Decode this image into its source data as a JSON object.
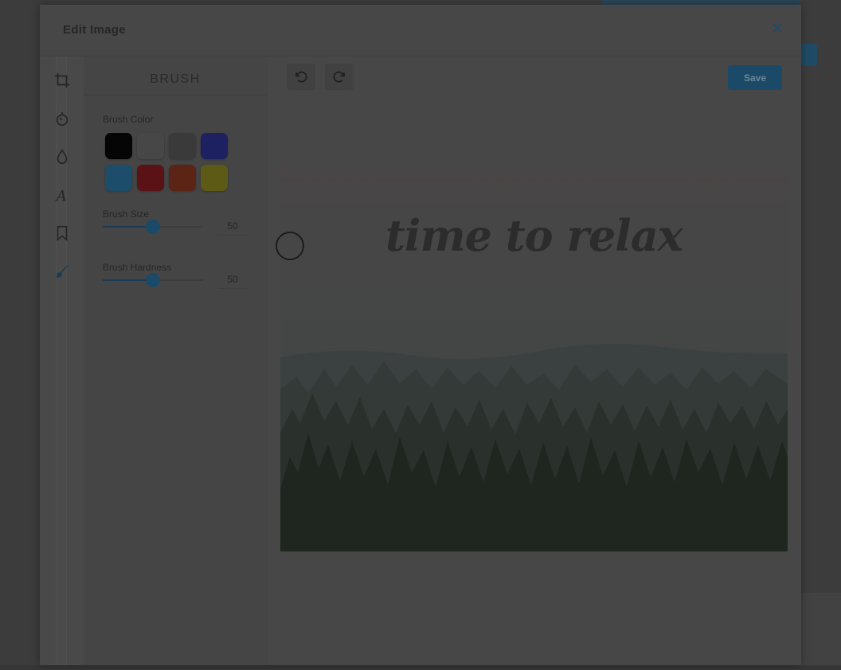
{
  "dialog": {
    "title": "Edit Image",
    "close_symbol": "✕"
  },
  "tools": [
    {
      "name": "crop-icon"
    },
    {
      "name": "brightness-icon"
    },
    {
      "name": "droplet-icon"
    },
    {
      "name": "text-icon"
    },
    {
      "name": "bookmark-icon"
    },
    {
      "name": "brush-icon"
    }
  ],
  "panel": {
    "title": "BRUSH",
    "brush_color_label": "Brush Color",
    "colors": [
      "#050505",
      "#474747",
      "#3a3a3a",
      "#1d2162",
      "#1c4e6b",
      "#5a1216",
      "#5c2414",
      "#5c5a14"
    ],
    "brush_size_label": "Brush Size",
    "brush_size_value": "50",
    "brush_size_fraction": 0.5,
    "brush_hardness_label": "Brush Hardness",
    "brush_hardness_value": "50",
    "brush_hardness_fraction": 0.5
  },
  "toolbar": {
    "save_label": "Save"
  },
  "canvas": {
    "overlay_text": "time to relax"
  },
  "colors": {
    "accent": "#1b4a68"
  }
}
